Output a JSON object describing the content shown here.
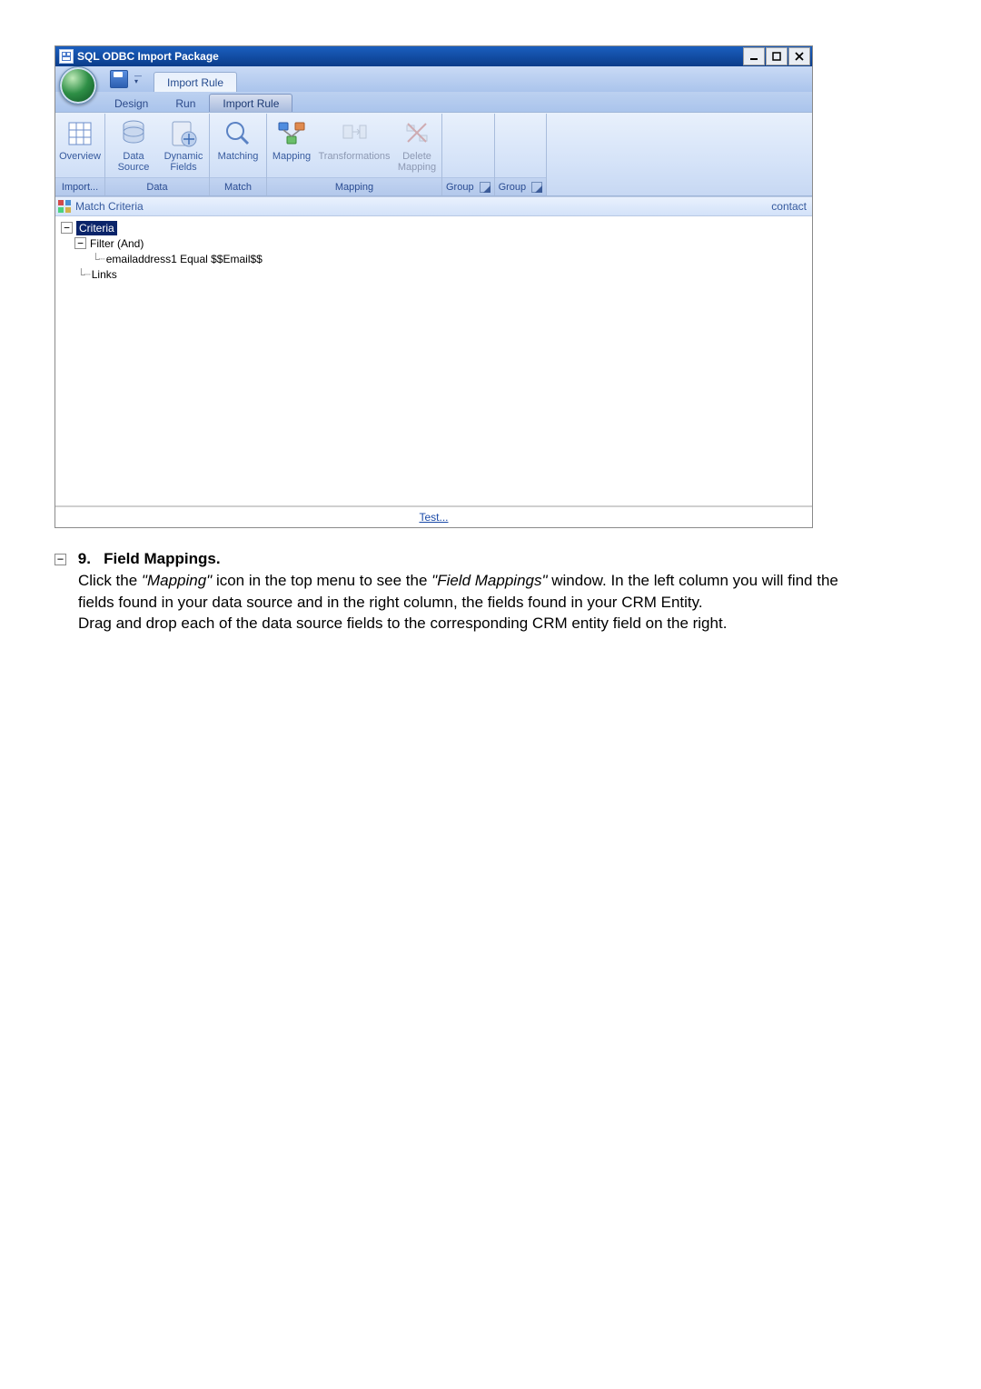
{
  "window": {
    "title": "SQL ODBC Import Package",
    "controls": {
      "min": "_",
      "max": "▫",
      "close": "✕"
    }
  },
  "ribbon": {
    "tabs_primary": [
      "Import Rule"
    ],
    "tabs_secondary": [
      "Design",
      "Run",
      "Import Rule"
    ],
    "active_primary": 0,
    "active_secondary": 2,
    "groups": [
      {
        "label": "Import...",
        "buttons": [
          {
            "label": "Overview",
            "icon": "overview"
          }
        ]
      },
      {
        "label": "Data",
        "buttons": [
          {
            "label": "Data Source",
            "icon": "datasource"
          },
          {
            "label": "Dynamic Fields",
            "icon": "dynfields"
          }
        ]
      },
      {
        "label": "Match",
        "buttons": [
          {
            "label": "Matching",
            "icon": "matching"
          }
        ]
      },
      {
        "label": "Mapping",
        "buttons": [
          {
            "label": "Mapping",
            "icon": "mapping"
          },
          {
            "label": "Transformations",
            "icon": "transform",
            "disabled": true
          },
          {
            "label": "Delete Mapping",
            "icon": "deletemap",
            "disabled": true
          }
        ]
      },
      {
        "label": "Group",
        "launcher": true,
        "buttons": [
          {
            "label": "",
            "icon": ""
          }
        ]
      },
      {
        "label": "Group",
        "launcher": true,
        "buttons": [
          {
            "label": "",
            "icon": ""
          }
        ]
      }
    ]
  },
  "panel": {
    "title": "Match Criteria",
    "right": "contact"
  },
  "tree": {
    "root": "Criteria",
    "filter": "Filter (And)",
    "condition": "emailaddress1 Equal $$Email$$",
    "links": "Links"
  },
  "test_link": "Test...",
  "instruction": {
    "num": "9.",
    "heading": "Field Mappings.",
    "body1a": "Click the ",
    "body1_em1": "\"Mapping\"",
    "body1b": " icon in the top menu to see the ",
    "body1_em2": "\"Field Mappings\"",
    "body1c": " window.  In the left column you will find the fields found in your data source and in the right column, the fields found in your CRM Entity.",
    "body2": "Drag and drop each of the data source fields to the corresponding CRM entity field on the right."
  }
}
